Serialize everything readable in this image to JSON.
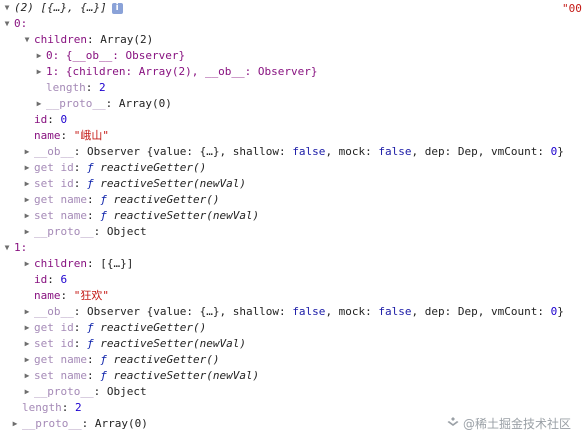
{
  "summary": "(2) [{…}, {…}]",
  "top_right_text": "\"00",
  "info_icon": "i",
  "item0": {
    "index_label": "0:",
    "children": {
      "label": "children",
      "value": "Array(2)",
      "entry0": "0: {__ob__: Observer}",
      "entry1": "1: {children: Array(2), __ob__: Observer}",
      "length_key": "length",
      "length_value": "2",
      "proto_key": "__proto__",
      "proto_value": "Array(0)"
    },
    "id_key": "id",
    "id_value": "0",
    "name_key": "name",
    "name_value": "\"峨山\"",
    "ob_key": "__ob__",
    "ob_value_prefix": "Observer {value: {…}, shallow: ",
    "ob_shallow": "false",
    "ob_mock_label": ", mock: ",
    "ob_mock": "false",
    "ob_rest": ", dep: Dep, vmCount: ",
    "ob_vmcount": "0",
    "ob_close": "}",
    "get_id": "get id",
    "set_id": "set id",
    "get_name": "get name",
    "set_name": "set name",
    "getter_fn": "reactiveGetter()",
    "setter_fn": "reactiveSetter(newVal)",
    "proto_key": "__proto__",
    "proto_value": "Object"
  },
  "item1": {
    "index_label": "1:",
    "children_key": "children",
    "children_value": "[{…}]",
    "id_key": "id",
    "id_value": "6",
    "name_key": "name",
    "name_value": "\"狂欢\"",
    "proto_key": "__proto__",
    "proto_value": "Object"
  },
  "f_glyph": "ƒ",
  "length_key": "length",
  "length_value": "2",
  "root_proto_key": "__proto__",
  "root_proto_value": "Array(0)",
  "watermark": "@稀土掘金技术社区",
  "colors": {
    "key": "#881280",
    "number": "#1c00cf",
    "string": "#c41a16",
    "keyword": "#1a1aa6"
  }
}
